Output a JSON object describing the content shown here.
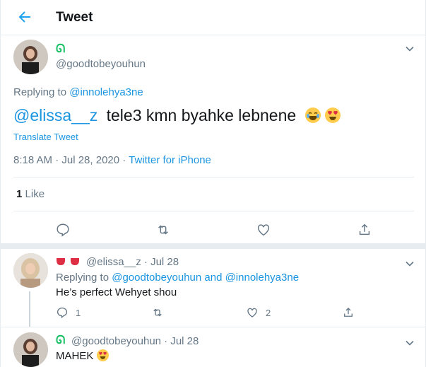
{
  "header": {
    "title": "Tweet"
  },
  "tweet": {
    "handle": "@goodtobeyouhun",
    "replying_to_prefix": "Replying to ",
    "replying_to": "@innolehya3ne",
    "mention": "@elissa__z",
    "text": "tele3 kmn byahke lebnene",
    "translate_label": "Translate Tweet",
    "time": "8:18 AM · Jul 28, 2020 · ",
    "source": "Twitter for iPhone",
    "likes_count": "1",
    "likes_label": "Like"
  },
  "replies": [
    {
      "handle_date": "@elissa__z · Jul 28",
      "replying_prefix": "Replying to ",
      "replying_to": "@goodtobeyouhun and @innolehya3ne",
      "text": "He’s perfect Wehyet shou",
      "reply_count": "1",
      "like_count": "2"
    },
    {
      "handle_date": "@goodtobeyouhun · Jul 28",
      "text": "MAHEK"
    }
  ],
  "icons": [
    "back-arrow-icon",
    "chevron-down-icon",
    "reply-icon",
    "retweet-icon",
    "like-icon",
    "share-icon",
    "laughing-emoji",
    "heart-eyes-emoji",
    "tongue-emoji"
  ],
  "colors": {
    "accent": "#1da1f2",
    "link": "#1b95e0",
    "muted": "#657786",
    "divider": "#e6ecf0"
  }
}
